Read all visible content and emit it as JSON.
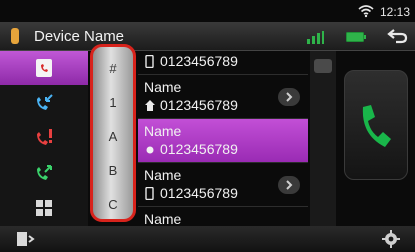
{
  "status": {
    "time": "12:13",
    "wifi_icon": "wifi-icon"
  },
  "header": {
    "title": "Device Name",
    "back_icon": "back-icon",
    "signal_icon": "signal-icon",
    "battery_icon": "battery-icon"
  },
  "sidebar": {
    "items": [
      {
        "name": "phonebook",
        "icon": "phonebook-icon",
        "active": true
      },
      {
        "name": "incoming-calls",
        "icon": "incoming-call-icon"
      },
      {
        "name": "missed-calls",
        "icon": "missed-call-icon"
      },
      {
        "name": "outgoing-calls",
        "icon": "outgoing-call-icon"
      },
      {
        "name": "keypad",
        "icon": "keypad-icon"
      }
    ]
  },
  "index": {
    "letters": [
      "#",
      "1",
      "A",
      "B",
      "C"
    ]
  },
  "contacts": [
    {
      "name": "",
      "number": "0123456789",
      "type": "mobile",
      "selected": false
    },
    {
      "name": "Name",
      "number": "0123456789",
      "type": "home",
      "selected": false
    },
    {
      "name": "Name",
      "number": "0123456789",
      "type": "other",
      "selected": true
    },
    {
      "name": "Name",
      "number": "0123456789",
      "type": "mobile",
      "selected": false
    },
    {
      "name": "Name",
      "number": "",
      "type": "",
      "selected": false
    }
  ],
  "colors": {
    "accent": "#b03dcc",
    "call_green": "#19b64a",
    "index_border": "#d8231c"
  }
}
